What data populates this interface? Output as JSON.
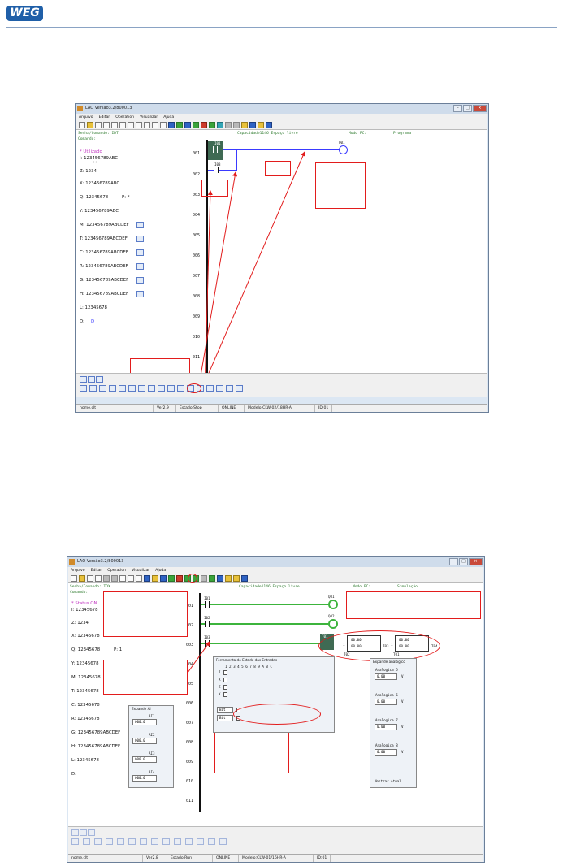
{
  "header": {
    "logo_text": "WEG"
  },
  "window1": {
    "title": "LAO Versão3.2/800013",
    "menu": [
      "Arquivo",
      "Editar",
      "Operation",
      "Visualizar",
      "Ajuda"
    ],
    "info_line1": "Senha/Comando: IDT",
    "info_line2": "Comando:",
    "capacity": "Capacidade1146 Espaço livre",
    "mode_label": "Modo PC:",
    "mode_value": "Programa",
    "left_rows": {
      "header": "* Utilizado",
      "i": "I: 123456789ABC",
      "i_sub": "* *",
      "z": "Z: 1234",
      "x": "X: 123456789ABC",
      "q": "Q: 12345678",
      "q_extra": "P: *",
      "y": "Y: 123456789ABC",
      "m": "M: 123456789ABCDEF",
      "t": "T: 123456789ABCDEF",
      "c": "C: 123456789ABCDEF",
      "r": "R: 123456789ABCDEF",
      "g": "G: 123456789ABCDEF",
      "h": "H: 123456789ABCDEF",
      "l": "L: 12345678",
      "d": "D:",
      "d_val": "D"
    },
    "rungs": [
      "001",
      "002",
      "003",
      "004",
      "005",
      "006",
      "007",
      "008",
      "009",
      "010",
      "011"
    ],
    "labels": {
      "i01": "I01",
      "i03": "I03",
      "q01": "Q01"
    },
    "status": {
      "file": "nome.clt",
      "version": "Ver2.9",
      "state": "Estado:Stop",
      "online": "ONLINE",
      "model": "Modelo:CLW-02/18HR-A",
      "id": "ID:01"
    }
  },
  "window2": {
    "title": "LAO Versão3.2/800013",
    "menu": [
      "Arquivo",
      "Editar",
      "Operation",
      "Visualizar",
      "Ajuda"
    ],
    "info_line1": "Senha/Comando: TDX",
    "info_line2": "Comando:",
    "capacity": "Capacidade1146 Espaço livre",
    "mode_label": "Modo PC:",
    "mode_value": "Simulação",
    "left_rows": {
      "header": "* Status ON",
      "i": "I: 12345678",
      "z": "Z: 1234",
      "x": "X: 12345678",
      "q": "Q: 12345678",
      "q_extra": "P: 1",
      "y": "Y: 12345678",
      "m": "M: 12345678",
      "t": "T: 12345678",
      "c": "C: 12345678",
      "r": "R: 12345678",
      "g": "G: 123456789ABCDEF",
      "h": "H: 123456789ABCDEF",
      "l": "L: 12345678",
      "d": "D:"
    },
    "rungs": [
      "001",
      "002",
      "003",
      "004",
      "005",
      "006",
      "007",
      "008",
      "009",
      "010",
      "011"
    ],
    "labels": {
      "i01": "I01",
      "i02": "I02",
      "i03": "I03",
      "q01": "Q01",
      "q02": "Q02",
      "t01": "T01",
      "t02": "T02",
      "t03": "T03",
      "t04": "T04",
      "t01b": "T01",
      "q03": "Q03"
    },
    "timer1": {
      "prefix": "1",
      "set": "00.00",
      "cur": "00.00"
    },
    "timer2": {
      "prefix": "1",
      "set": "00.00",
      "cur": "00.00"
    },
    "input_tool": {
      "title": "Ferramenta do Estado das Entradas",
      "cols": "1 2 3 4 5 6 7 8 9 A B C",
      "rows": [
        "I",
        "X",
        "Z",
        "X"
      ],
      "select1": "Bit",
      "select2": "Bit"
    },
    "expand_ai": {
      "title": "Expande AI",
      "items": [
        {
          "name": "AI1",
          "value": "000.0"
        },
        {
          "name": "AI2",
          "value": "000.0"
        },
        {
          "name": "AI3",
          "value": "000.0"
        },
        {
          "name": "AI4",
          "value": "000.0"
        }
      ]
    },
    "expand_analog": {
      "title": "Expande analógico",
      "items": [
        {
          "name": "Analogica 5",
          "value": "0.00",
          "unit": "V"
        },
        {
          "name": "Analogica 6",
          "value": "0.00",
          "unit": "V"
        },
        {
          "name": "Analogica 7",
          "value": "0.00",
          "unit": "V"
        },
        {
          "name": "Analogica 8",
          "value": "0.00",
          "unit": "V"
        }
      ],
      "button": "Mostrar Atual"
    },
    "status": {
      "file": "nome.clt",
      "version": "Ver2.8",
      "state": "Estado:Run",
      "online": "ONLINE",
      "model": "Modelo:CLW-01/16HR-A",
      "id": "ID:01"
    }
  },
  "colors": {
    "accent": "#1f5fa8",
    "ladder_blue": "#3a3aff",
    "sim_green": "#3cb43c",
    "callout_red": "#e21c1c"
  }
}
